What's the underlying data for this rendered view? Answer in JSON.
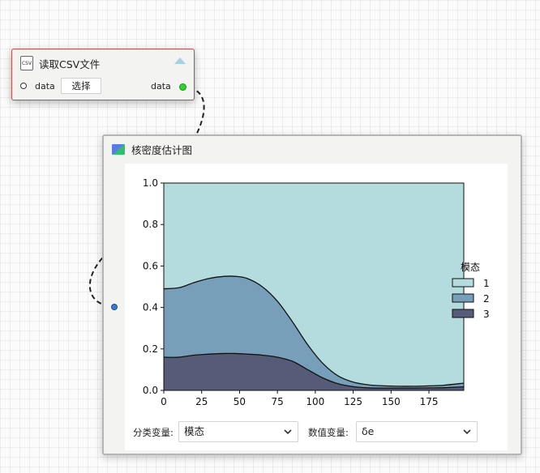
{
  "csv_node": {
    "icon": "csv-file-icon",
    "icon_text": "CSV",
    "title": "读取CSV文件",
    "input_port_label": "data",
    "select_button_label": "选择",
    "output_port_label": "data"
  },
  "kde_node": {
    "icon": "chart-icon",
    "title": "核密度估计图",
    "controls": {
      "category_label": "分类变量:",
      "category_value": "模态",
      "numeric_label": "数值变量:",
      "numeric_value": "δe"
    }
  },
  "colors": {
    "series1": "#b4dcdf",
    "series2": "#779fb9",
    "series3": "#565b77",
    "csv_border": "#c0504d",
    "port_out": "#2ed12e",
    "port_in": "#3a7bd5"
  },
  "chart_data": {
    "type": "area",
    "stacked": "fill",
    "xlim": [
      0,
      198
    ],
    "ylim": [
      0,
      1
    ],
    "x_ticks": [
      0,
      25,
      50,
      75,
      100,
      125,
      150,
      175
    ],
    "y_ticks": [
      "0.0",
      "0.2",
      "0.4",
      "0.6",
      "0.8",
      "1.0"
    ],
    "legend_title": "模态",
    "legend_position": "right",
    "x": [
      0,
      10,
      20,
      30,
      40,
      47,
      55,
      65,
      75,
      85,
      95,
      105,
      115,
      125,
      135,
      145,
      155,
      165,
      175,
      185,
      198
    ],
    "series": [
      {
        "name": "1",
        "values": [
          0.51,
          0.505,
          0.48,
          0.46,
          0.45,
          0.45,
          0.46,
          0.5,
          0.57,
          0.67,
          0.78,
          0.87,
          0.93,
          0.96,
          0.973,
          0.978,
          0.98,
          0.98,
          0.978,
          0.975,
          0.965
        ]
      },
      {
        "name": "2",
        "values": [
          0.33,
          0.335,
          0.35,
          0.365,
          0.372,
          0.372,
          0.365,
          0.33,
          0.27,
          0.19,
          0.12,
          0.07,
          0.038,
          0.022,
          0.015,
          0.011,
          0.009,
          0.009,
          0.01,
          0.012,
          0.018
        ]
      },
      {
        "name": "3",
        "values": [
          0.16,
          0.16,
          0.17,
          0.175,
          0.178,
          0.178,
          0.175,
          0.17,
          0.16,
          0.14,
          0.1,
          0.06,
          0.032,
          0.018,
          0.012,
          0.011,
          0.011,
          0.011,
          0.012,
          0.013,
          0.017
        ]
      }
    ]
  }
}
